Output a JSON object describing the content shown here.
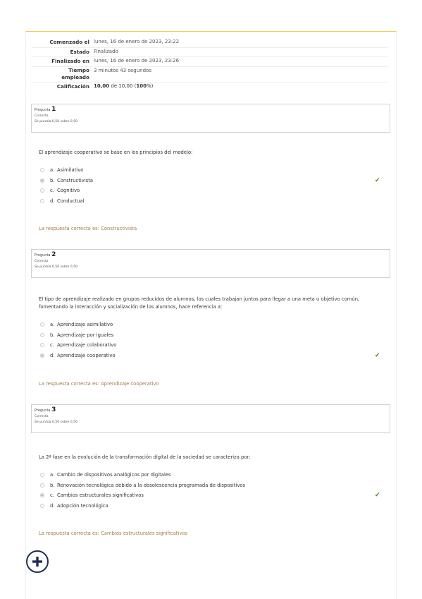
{
  "summary": {
    "started_label": "Comenzado el",
    "started_value": "lunes, 16 de enero de 2023, 23:22",
    "state_label": "Estado",
    "state_value": "Finalizado",
    "finished_label": "Finalizado en",
    "finished_value": "lunes, 16 de enero de 2023, 23:26",
    "time_label_1": "Tiempo",
    "time_label_2": "empleado",
    "time_value": "3 minutos 43 segundos",
    "grade_label": "Calificación",
    "grade_value_bold": "10,00",
    "grade_value_mid": " de 10,00 (",
    "grade_value_pct": "100",
    "grade_value_end": "%)"
  },
  "questions": [
    {
      "label": "Pregunta",
      "number": "1",
      "status": "Correcta",
      "points": "Se puntúa 0,50 sobre 0,50",
      "text": "El aprendizaje cooperativo se base en los principios del modelo:",
      "answers": [
        {
          "letter": "a.",
          "text": "Asimilativo"
        },
        {
          "letter": "b.",
          "text": "Constructivista"
        },
        {
          "letter": "c.",
          "text": "Cognitivo"
        },
        {
          "letter": "d.",
          "text": "Conductual"
        }
      ],
      "selected_index": 1,
      "feedback": "La respuesta correcta es: Constructivista"
    },
    {
      "label": "Pregunta",
      "number": "2",
      "status": "Correcta",
      "points": "Se puntúa 0,50 sobre 0,50",
      "text": "El tipo de aprendizaje realizado en grupos reducidos de alumnos, los cuales trabajan juntos para llegar a una meta u objetivo común, fomentando la interacción y socialización de los alumnos, hace referencia a:",
      "answers": [
        {
          "letter": "a.",
          "text": "Aprendizaje asimilativo"
        },
        {
          "letter": "b.",
          "text": "Aprendizaje por iguales"
        },
        {
          "letter": "c.",
          "text": "Aprendizaje colaborativo"
        },
        {
          "letter": "d.",
          "text": "Aprendizaje cooperativo"
        }
      ],
      "selected_index": 3,
      "feedback": "La respuesta correcta es: Aprendizaje cooperativo"
    },
    {
      "label": "Pregunta",
      "number": "3",
      "status": "Correcta",
      "points": "Se puntúa 0,50 sobre 0,50",
      "text": "La 2ª fase en la evolución de la transformación digital de la sociedad se caracteriza por:",
      "answers": [
        {
          "letter": "a.",
          "text": "Cambio de dispositivos analógicos por digitales"
        },
        {
          "letter": "b.",
          "text": "Renovación tecnológica debido a la obsolescencia programada de dispositivos"
        },
        {
          "letter": "c.",
          "text": "Cambios estructurales significativos"
        },
        {
          "letter": "d.",
          "text": "Adopción tecnológica"
        }
      ],
      "selected_index": 2,
      "feedback": "La respuesta correcta es: Cambios estructurales significativos"
    }
  ],
  "check_icon": "✔",
  "colors": {
    "accent_top": "#f0cc57",
    "correct": "#4a8a2a",
    "feedback": "#a07d4a",
    "fab": "#1d2e57"
  }
}
